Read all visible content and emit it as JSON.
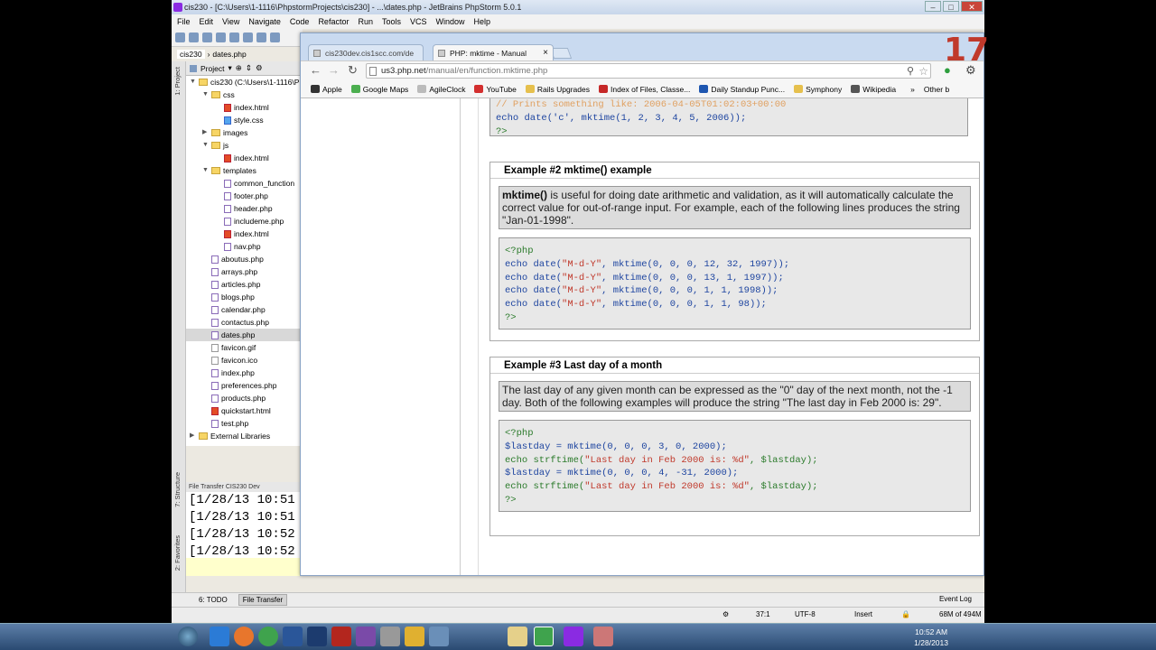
{
  "ide": {
    "title": "cis230 - [C:\\Users\\1-1116\\PhpstormProjects\\cis230] - ...\\dates.php - JetBrains PhpStorm 5.0.1",
    "menu": [
      "File",
      "Edit",
      "View",
      "Navigate",
      "Code",
      "Refactor",
      "Run",
      "Tools",
      "VCS",
      "Window",
      "Help"
    ],
    "editor_tabs": [
      "cis230",
      "dates.php"
    ],
    "project_label": "Project",
    "tree": [
      {
        "label": "cis230 (C:\\Users\\1-1116\\P",
        "depth": 0,
        "type": "folder",
        "twist": "▼"
      },
      {
        "label": "css",
        "depth": 1,
        "type": "folder",
        "twist": "▼"
      },
      {
        "label": "index.html",
        "depth": 2,
        "type": "html",
        "twist": ""
      },
      {
        "label": "style.css",
        "depth": 2,
        "type": "css",
        "twist": ""
      },
      {
        "label": "images",
        "depth": 1,
        "type": "folder",
        "twist": "▶"
      },
      {
        "label": "js",
        "depth": 1,
        "type": "folder",
        "twist": "▼"
      },
      {
        "label": "index.html",
        "depth": 2,
        "type": "html",
        "twist": ""
      },
      {
        "label": "templates",
        "depth": 1,
        "type": "folder",
        "twist": "▼"
      },
      {
        "label": "common_function",
        "depth": 2,
        "type": "php",
        "twist": ""
      },
      {
        "label": "footer.php",
        "depth": 2,
        "type": "php",
        "twist": ""
      },
      {
        "label": "header.php",
        "depth": 2,
        "type": "php",
        "twist": ""
      },
      {
        "label": "includeme.php",
        "depth": 2,
        "type": "php",
        "twist": ""
      },
      {
        "label": "index.html",
        "depth": 2,
        "type": "html",
        "twist": ""
      },
      {
        "label": "nav.php",
        "depth": 2,
        "type": "php",
        "twist": ""
      },
      {
        "label": "aboutus.php",
        "depth": 1,
        "type": "php",
        "twist": ""
      },
      {
        "label": "arrays.php",
        "depth": 1,
        "type": "php",
        "twist": ""
      },
      {
        "label": "articles.php",
        "depth": 1,
        "type": "php",
        "twist": ""
      },
      {
        "label": "blogs.php",
        "depth": 1,
        "type": "php",
        "twist": ""
      },
      {
        "label": "calendar.php",
        "depth": 1,
        "type": "php",
        "twist": ""
      },
      {
        "label": "contactus.php",
        "depth": 1,
        "type": "php",
        "twist": ""
      },
      {
        "label": "dates.php",
        "depth": 1,
        "type": "php",
        "twist": "",
        "selected": true
      },
      {
        "label": "favicon.gif",
        "depth": 1,
        "type": "img",
        "twist": ""
      },
      {
        "label": "favicon.ico",
        "depth": 1,
        "type": "img",
        "twist": ""
      },
      {
        "label": "index.php",
        "depth": 1,
        "type": "php",
        "twist": ""
      },
      {
        "label": "preferences.php",
        "depth": 1,
        "type": "php",
        "twist": ""
      },
      {
        "label": "products.php",
        "depth": 1,
        "type": "php",
        "twist": ""
      },
      {
        "label": "quickstart.html",
        "depth": 1,
        "type": "html",
        "twist": ""
      },
      {
        "label": "test.php",
        "depth": 1,
        "type": "php",
        "twist": ""
      },
      {
        "label": "External Libraries",
        "depth": 0,
        "type": "lib",
        "twist": "▶"
      }
    ],
    "file_transfer_header": "File Transfer  CIS230 Dev",
    "log_lines": [
      "[1/28/13 10:51",
      "[1/28/13 10:51",
      "[1/28/13 10:52",
      "[1/28/13 10:52"
    ],
    "side_labels": [
      "1: Project",
      "7: Structure",
      "2: Favorites"
    ],
    "bottom_tabs": [
      "6: TODO",
      "File Transfer"
    ],
    "event_log": "Event Log",
    "status": {
      "position": "37:1",
      "encoding": "UTF-8",
      "mode": "Insert",
      "memory": "68M of 494M"
    }
  },
  "browser": {
    "tabs": [
      {
        "label": "cis230dev.cis1scc.com/de",
        "active": false
      },
      {
        "label": "PHP: mktime - Manual",
        "active": true
      }
    ],
    "url_host": "us3.php.net",
    "url_path": "/manual/en/function.mktime.php",
    "bookmarks": [
      {
        "label": "Apple",
        "color": "#333"
      },
      {
        "label": "Google Maps",
        "color": "#4caf50"
      },
      {
        "label": "AgileClock",
        "color": "#bbb"
      },
      {
        "label": "YouTube",
        "color": "#d32f2f"
      },
      {
        "label": "Rails Upgrades",
        "color": "#e6c04d"
      },
      {
        "label": "Index of Files, Classe...",
        "color": "#c62828"
      },
      {
        "label": "Daily Standup Punc...",
        "color": "#1e56b0"
      },
      {
        "label": "Symphony",
        "color": "#e6c04d"
      },
      {
        "label": "Wikipedia",
        "color": "#555"
      }
    ],
    "other_bookmarks": "Other b"
  },
  "doc": {
    "top_code_line1": "// Prints something like: 2006-04-05T01:02:03+00:00",
    "top_code_line2": "echo date('c', mktime(1, 2, 3, 4, 5, 2006));",
    "top_code_line3": "?>",
    "ex2_title": "Example #2 mktime() example",
    "ex2_desc_fn": "mktime()",
    "ex2_desc": " is useful for doing date arithmetic and validation, as it will automatically calculate the correct value for out-of-range input. For example, each of the following lines produces the string \"Jan-01-1998\".",
    "ex3_title": "Example #3 Last day of a month",
    "ex3_desc": "The last day of any given month can be expressed as the \"0\" day of the next month, not the -1 day. Both of the following examples will produce the string \"The last day in Feb 2000 is: 29\"."
  },
  "taskbar": {
    "time": "10:52 AM",
    "date": "1/28/2013"
  },
  "overlay_number": "17"
}
